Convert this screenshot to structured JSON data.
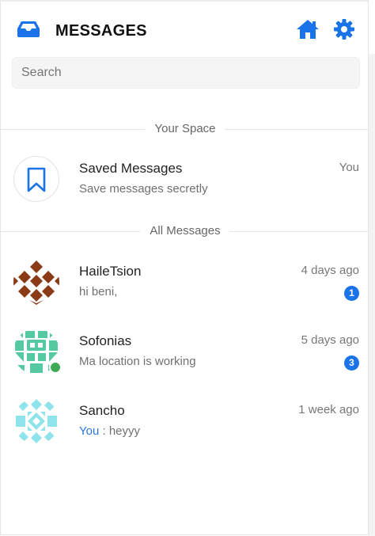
{
  "header": {
    "title": "MESSAGES",
    "logo_icon": "inbox-tray-icon",
    "home_icon": "home-icon",
    "settings_icon": "gear-icon",
    "accent_color": "#1a73e8"
  },
  "search": {
    "placeholder": "Search",
    "value": ""
  },
  "sections": {
    "your_space": "Your Space",
    "all_messages": "All Messages"
  },
  "saved": {
    "name": "Saved Messages",
    "preview": "Save messages secretly",
    "time": "You",
    "icon": "bookmark-icon"
  },
  "conversations": [
    {
      "name": "HaileTsion",
      "preview": "hi beni,",
      "time": "4 days ago",
      "unread": "1",
      "online": false
    },
    {
      "name": "Sofonias",
      "preview": "Ma location is working",
      "time": "5 days ago",
      "unread": "3",
      "online": true
    },
    {
      "name": "Sancho",
      "preview_sender": "You",
      "preview_sep": " : ",
      "preview": "heyyy",
      "time": "1 week ago",
      "unread": "",
      "online": false
    }
  ]
}
